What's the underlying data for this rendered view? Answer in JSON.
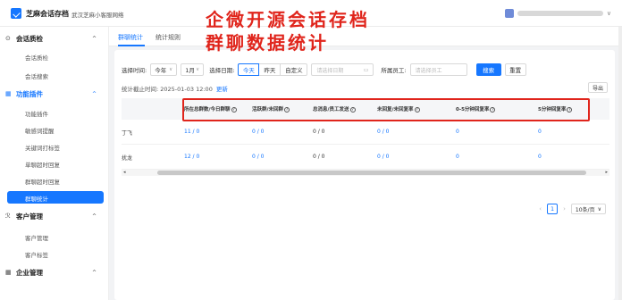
{
  "header": {
    "app_name": "芝麻会话存档",
    "company": "武汉芝麻小客服网络",
    "user_caret": "∨"
  },
  "overlay": {
    "line1": "企微开源会话存档",
    "line2": "群聊数据统计"
  },
  "sidebar": {
    "groups": [
      {
        "icon": "⊙",
        "label": "会话质检",
        "caret": "^"
      },
      {
        "icon": "▦",
        "label": "功能插件",
        "caret": "^"
      },
      {
        "icon": "ℛ",
        "label": "客户管理",
        "caret": "^"
      },
      {
        "icon": "▦",
        "label": "企业管理",
        "caret": "^"
      }
    ],
    "session_items": [
      "会话质检",
      "会话搜索"
    ],
    "plugin_items": [
      "功能插件",
      "敏感词提醒",
      "关键词打标签",
      "单聊超时回复",
      "群聊超时回复",
      "群聊统计"
    ],
    "customer_items": [
      "客户管理",
      "客户标签"
    ]
  },
  "tabs": [
    "群聊统计",
    "统计规则"
  ],
  "filters": {
    "time_label": "选择时间:",
    "year": "今年",
    "month": "1月",
    "date_label": "选择日期:",
    "today": "今天",
    "yesterday": "昨天",
    "custom": "自定义",
    "date_placeholder": "请选择日期",
    "staff_label": "所属员工:",
    "staff_placeholder": "请选择员工",
    "search": "搜索",
    "reset": "重置"
  },
  "info": {
    "deadline": "统计截止时间: 2025-01-03 12:00",
    "refresh": "更新"
  },
  "export": "导出",
  "table": {
    "columns": [
      "所在总群数/今日群聊",
      "活跃群/未回群",
      "总消息/员工发送",
      "未回复/未回复率",
      "0-5分钟回复率",
      "5分钟回复率"
    ],
    "rows": [
      {
        "name": "丁飞",
        "cells": [
          "11 / 0",
          "0 / 0",
          "0 / 0",
          "0 / 0",
          "0",
          "0"
        ]
      },
      {
        "name": "扰龙",
        "cells": [
          "12 / 0",
          "0 / 0",
          "0 / 0",
          "0 / 0",
          "0",
          "0"
        ]
      }
    ]
  },
  "pager": {
    "page": "1",
    "size": "10条/页"
  }
}
